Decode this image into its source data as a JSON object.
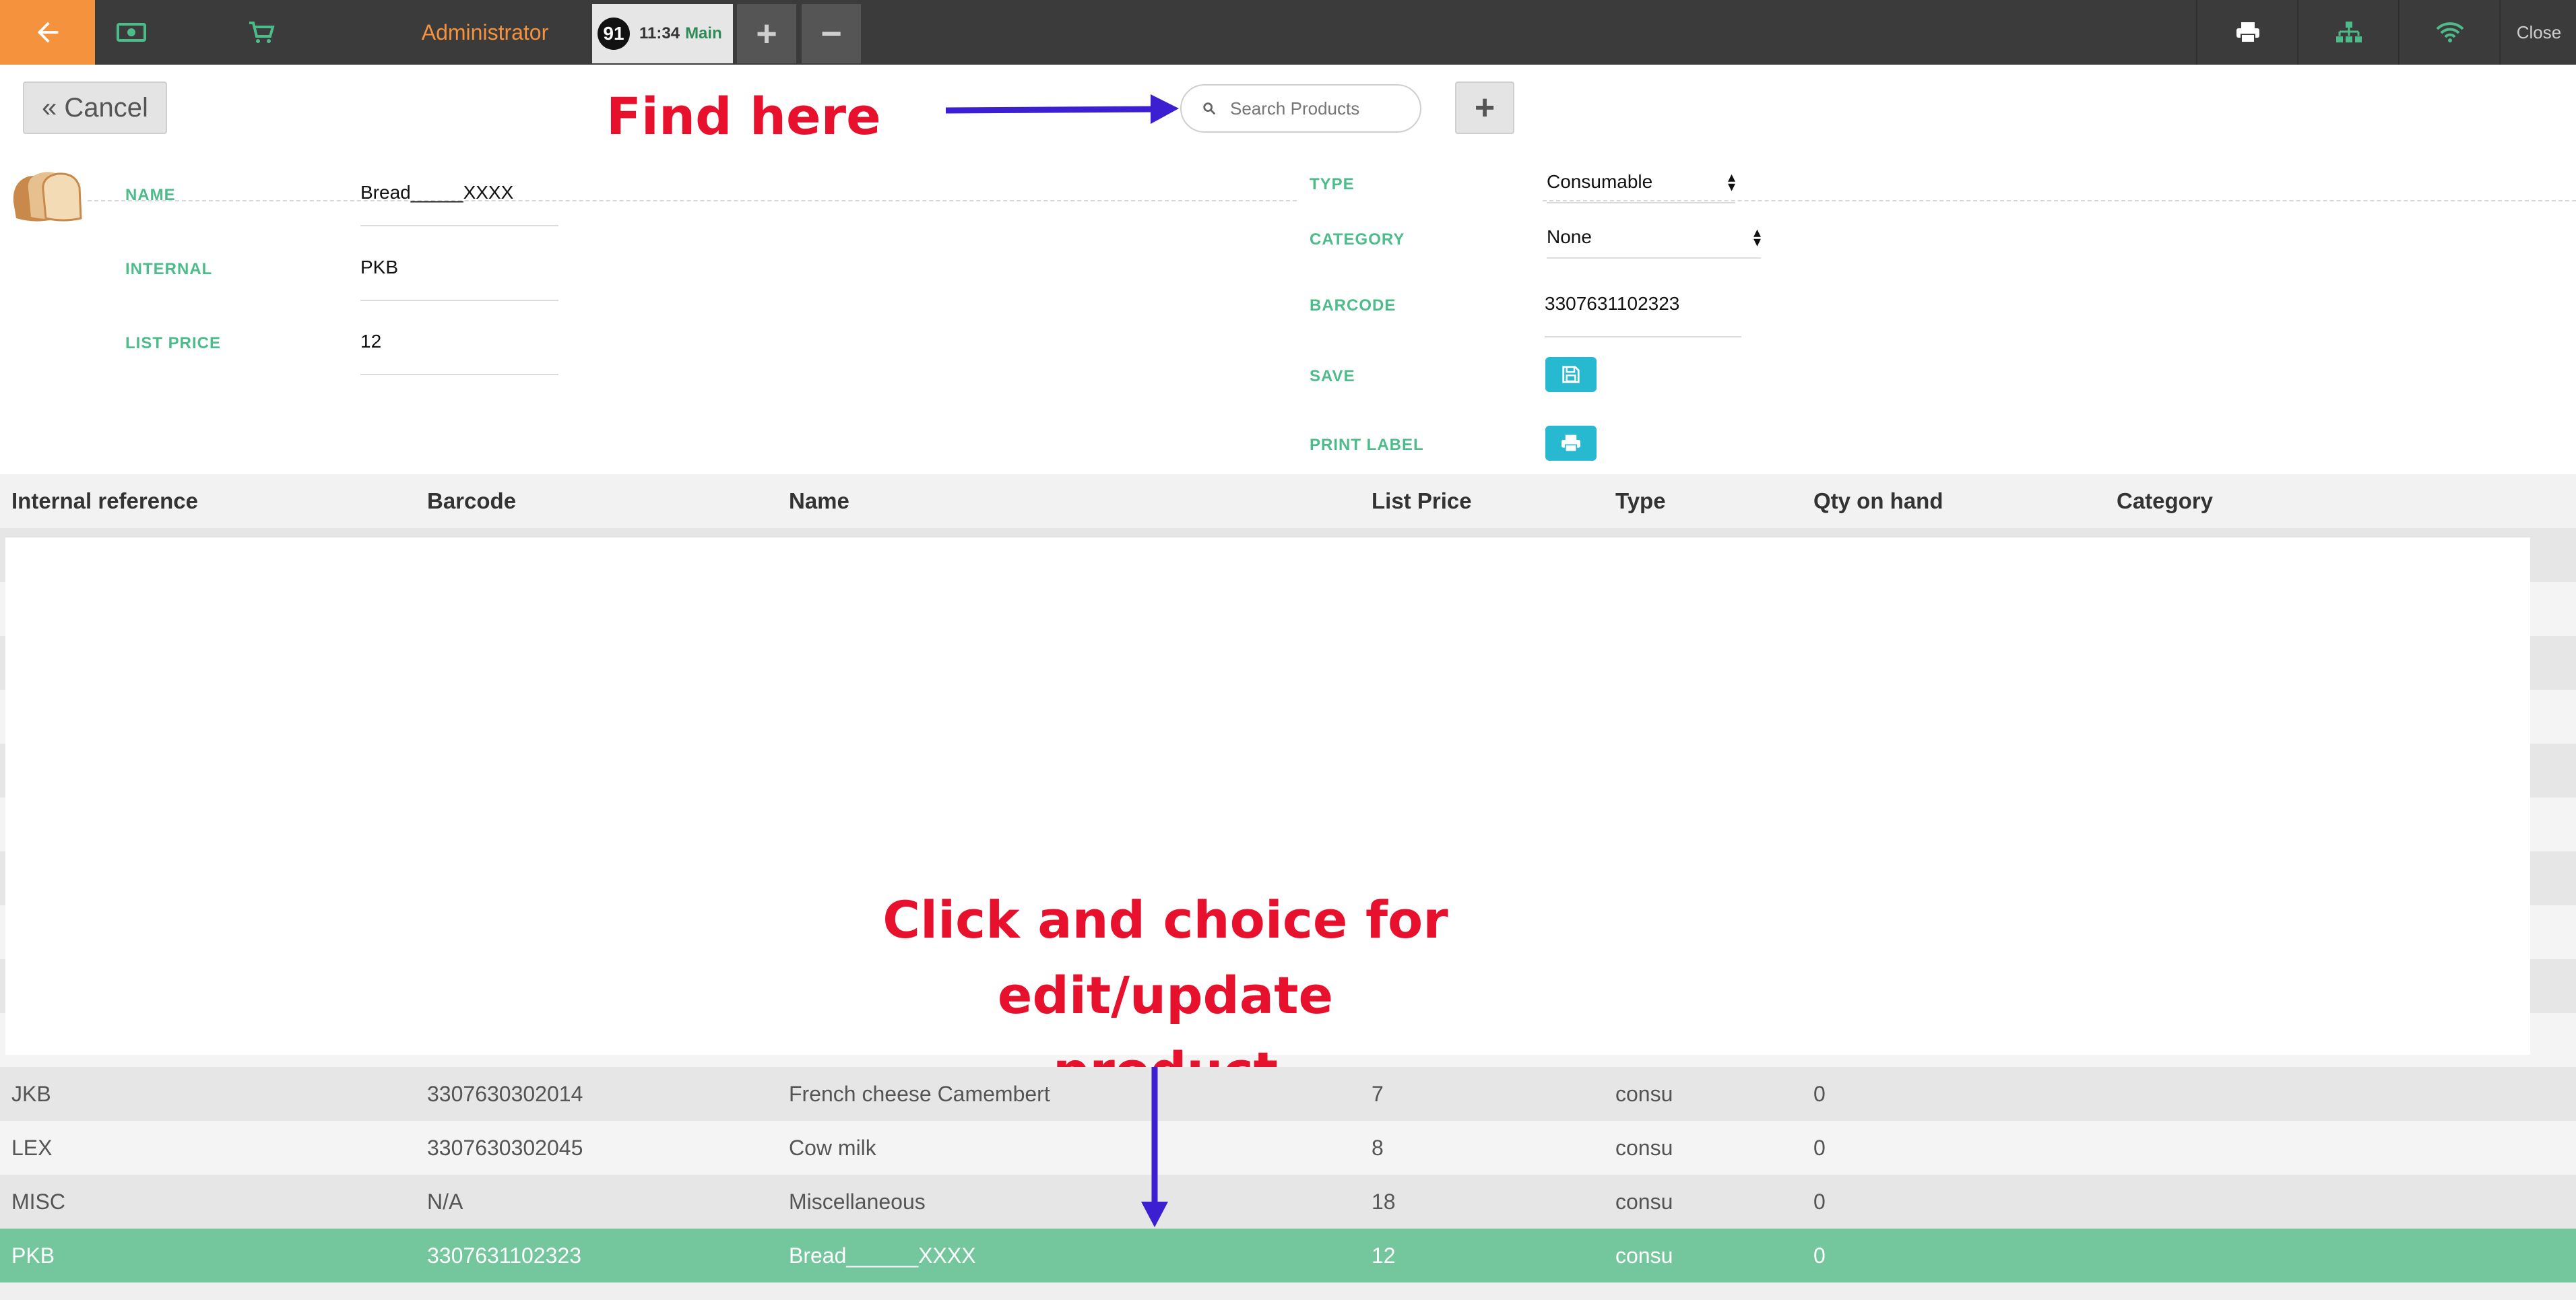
{
  "topbar": {
    "admin_label": "Administrator",
    "order_number": "91",
    "order_time": "11:34",
    "order_name": "Main",
    "plus_label": "+",
    "minus_label": "−",
    "close_label": "Close",
    "icons": [
      "back-arrow-icon",
      "cash-icon",
      "cart-icon",
      "print-icon",
      "network-icon",
      "wifi-icon"
    ],
    "colors": {
      "accent_orange": "#f5923e",
      "bar_bg": "#3b3b3b",
      "green": "#4cbc8a"
    }
  },
  "toolbar": {
    "cancel_label": "« Cancel",
    "search_placeholder": "Search Products",
    "add_label": "+"
  },
  "annotations": {
    "find_here": "Find here",
    "click_choice_line1": "Click and choice for edit/update",
    "click_choice_line2": "product"
  },
  "form": {
    "name_label": "NAME",
    "name_value": "Bread_____XXXX",
    "internal_label": "INTERNAL",
    "internal_value": "PKB",
    "list_price_label": "LIST PRICE",
    "list_price_value": "12",
    "type_label": "TYPE",
    "type_value": "Consumable",
    "category_label": "CATEGORY",
    "category_value": "None",
    "barcode_label": "BARCODE",
    "barcode_value": "3307631102323",
    "save_label": "SAVE",
    "print_label_label": "PRINT LABEL"
  },
  "table": {
    "headers": [
      "Internal reference",
      "Barcode",
      "Name",
      "List Price",
      "Type",
      "Qty on hand",
      "Category"
    ],
    "rows": [
      {
        "ref": "JKB",
        "barcode": "3307630302014",
        "name": "French cheese Camembert",
        "price": "7",
        "type": "consu",
        "qty": "0",
        "category": ""
      },
      {
        "ref": "LEX",
        "barcode": "3307630302045",
        "name": "Cow milk",
        "price": "8",
        "type": "consu",
        "qty": "0",
        "category": ""
      },
      {
        "ref": "MISC",
        "barcode": "N/A",
        "name": "Miscellaneous",
        "price": "18",
        "type": "consu",
        "qty": "0",
        "category": ""
      },
      {
        "ref": "PKB",
        "barcode": "3307631102323",
        "name": "Bread______XXXX",
        "price": "12",
        "type": "consu",
        "qty": "0",
        "category": ""
      }
    ],
    "selected_row_color": "#74c69d"
  }
}
